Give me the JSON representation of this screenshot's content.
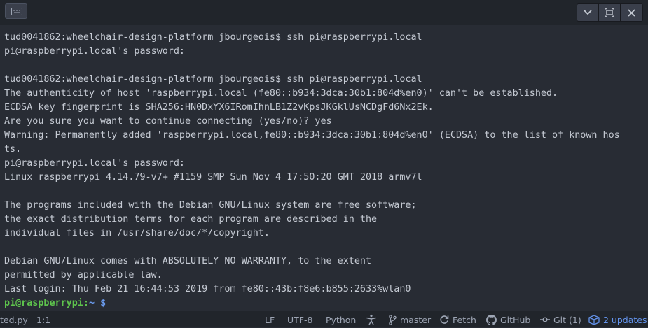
{
  "terminal": {
    "lines": [
      "tud0041862:wheelchair-design-platform jbourgeois$ ssh pi@raspberrypi.local",
      "pi@raspberrypi.local's password:",
      "",
      "tud0041862:wheelchair-design-platform jbourgeois$ ssh pi@raspberrypi.local",
      "The authenticity of host 'raspberrypi.local (fe80::b934:3dca:30b1:804d%en0)' can't be established.",
      "ECDSA key fingerprint is SHA256:HN0DxYX6IRomIhnLB1Z2vKpsJKGklUsNCDgFd6Nx2Ek.",
      "Are you sure you want to continue connecting (yes/no)? yes",
      "Warning: Permanently added 'raspberrypi.local,fe80::b934:3dca:30b1:804d%en0' (ECDSA) to the list of known hos",
      "ts.",
      "pi@raspberrypi.local's password:",
      "Linux raspberrypi 4.14.79-v7+ #1159 SMP Sun Nov 4 17:50:20 GMT 2018 armv7l",
      "",
      "The programs included with the Debian GNU/Linux system are free software;",
      "the exact distribution terms for each program are described in the",
      "individual files in /usr/share/doc/*/copyright.",
      "",
      "Debian GNU/Linux comes with ABSOLUTELY NO WARRANTY, to the extent",
      "permitted by applicable law.",
      "Last login: Thu Feb 21 16:44:53 2019 from fe80::43b:f8e6:b855:2633%wlan0"
    ],
    "prompt": {
      "user": "pi@raspberrypi",
      "separator": ":",
      "path": "~",
      "symbol": "$"
    }
  },
  "statusbar": {
    "file": "ted.py",
    "cursor": "1:1",
    "line_ending": "LF",
    "encoding": "UTF-8",
    "grammar": "Python",
    "branch": "master",
    "fetch": "Fetch",
    "github": "GitHub",
    "git": "Git (1)",
    "updates": "2 updates"
  },
  "icons": {
    "keyboard": "keyboard-icon",
    "chevron": "chevron-down-icon",
    "maximize": "maximize-icon",
    "close": "close-icon",
    "accessibility": "accessibility-icon",
    "branch": "git-branch-icon",
    "fetch": "sync-icon",
    "github": "github-icon",
    "git": "git-commit-icon",
    "package": "package-icon"
  },
  "colors": {
    "background": "#282c34",
    "text": "#c5cad3",
    "prompt_user": "#5ec44d",
    "prompt_path": "#6b9cf0",
    "updates": "#6494ed"
  }
}
